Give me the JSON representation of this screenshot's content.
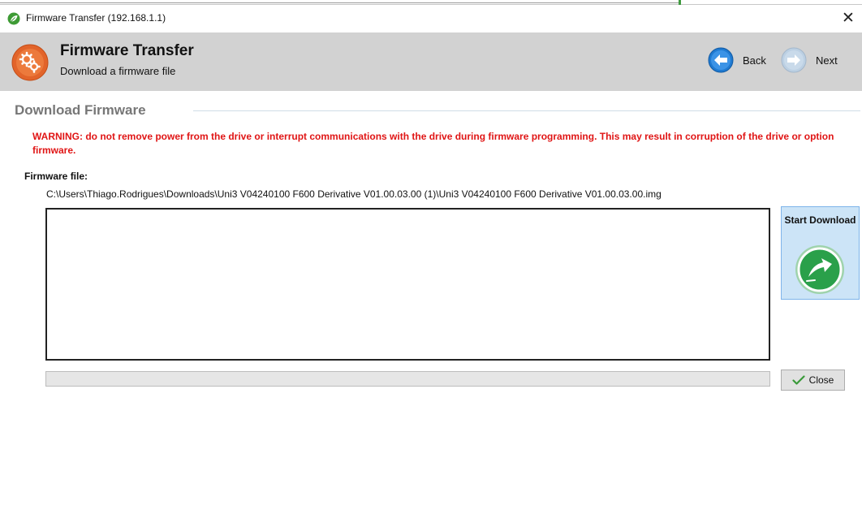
{
  "window": {
    "title": "Firmware Transfer (192.168.1.1)",
    "app_icon": "leaf-icon",
    "close_icon": "close-icon",
    "close_glyph": "✕"
  },
  "header": {
    "title": "Firmware Transfer",
    "subtitle": "Download a firmware file",
    "icon": "gears-icon",
    "back_label": "Back",
    "next_label": "Next"
  },
  "section": {
    "title": "Download Firmware",
    "warning": "WARNING: do not remove power from the drive or interrupt communications with the drive during firmware programming. This may result in corruption of the drive or option firmware."
  },
  "firmware": {
    "label": "Firmware file:",
    "path": "C:\\Users\\Thiago.Rodrigues\\Downloads\\Uni3 V04240100 F600 Derivative V01.00.03.00 (1)\\Uni3 V04240100 F600 Derivative V01.00.03.00.img",
    "log_text": ""
  },
  "actions": {
    "start_label": "Start Download",
    "start_icon": "download-arrow-icon",
    "close_label": "Close",
    "close_icon": "checkmark-icon"
  },
  "progress": {
    "value_percent": 0
  },
  "colors": {
    "warning": "#e01515",
    "header_bg": "#d2d2d2",
    "section_title": "#777777",
    "start_button_bg": "#cce4f7",
    "nav_blue": "#1f7ad1",
    "download_green": "#2aa04a"
  }
}
